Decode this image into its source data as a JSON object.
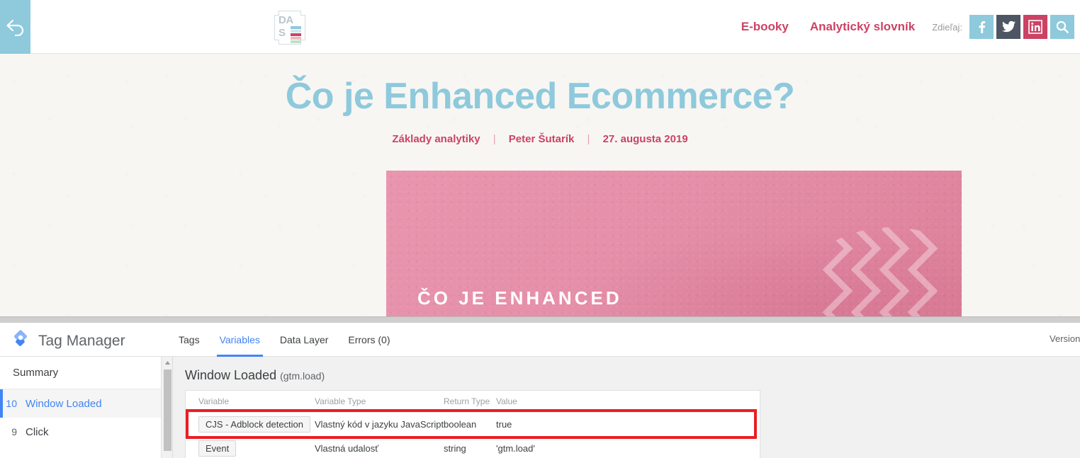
{
  "site": {
    "back_button": {
      "icon": "back-arrow-icon",
      "bg": "#8ec9dc"
    },
    "logo": {
      "line1": "DA",
      "line2": "S",
      "bars": [
        "#8ec9dc",
        "#cfe6ef",
        "#cc4264",
        "#f1b8c6",
        "#bfe0c6"
      ]
    },
    "nav": [
      {
        "label": "E-booky"
      },
      {
        "label": "Analytický slovník"
      }
    ],
    "share": {
      "label": "Zdieľaj:",
      "items": [
        {
          "name": "facebook-icon",
          "bg": "#8ec9dc"
        },
        {
          "name": "twitter-icon",
          "bg": "#4e5664"
        },
        {
          "name": "linkedin-icon",
          "bg": "#cc4264"
        },
        {
          "name": "search-icon",
          "bg": "#8ec9dc"
        }
      ]
    }
  },
  "article": {
    "title": "Čo je Enhanced Ecommerce?",
    "category": "Základy analytiky",
    "author": "Peter Šutarík",
    "date": "27. augusta 2019",
    "separator": "|",
    "hero_text": "ČO JE ENHANCED",
    "title_color": "#8ec9dc",
    "meta_color": "#cc4264",
    "hero_color": "#e58fa9"
  },
  "gtm": {
    "brand": "Tag Manager",
    "logo_name": "tag-manager-logo-icon",
    "tabs": [
      {
        "label": "Tags",
        "active": false
      },
      {
        "label": "Variables",
        "active": true
      },
      {
        "label": "Data Layer",
        "active": false
      },
      {
        "label": "Errors (0)",
        "active": false
      }
    ],
    "version_label": "Version:",
    "accent": "#4285f4",
    "sidebar": {
      "summary": "Summary",
      "events": [
        {
          "num": "10",
          "label": "Window Loaded",
          "selected": true
        },
        {
          "num": "9",
          "label": "Click",
          "selected": false
        }
      ]
    },
    "content": {
      "title": "Window Loaded",
      "event_name": "(gtm.load)",
      "table": {
        "headers": [
          "Variable",
          "Variable Type",
          "Return Type",
          "Value"
        ],
        "rows": [
          {
            "variable": "CJS - Adblock detection",
            "variable_type": "Vlastný kód v jazyku JavaScript",
            "return_type": "boolean",
            "value": "true",
            "highlighted": true
          },
          {
            "variable": "Event",
            "variable_type": "Vlastná udalosť",
            "return_type": "string",
            "value": "'gtm.load'",
            "highlighted": false
          }
        ]
      }
    },
    "highlight_color": "#ed1c24"
  }
}
